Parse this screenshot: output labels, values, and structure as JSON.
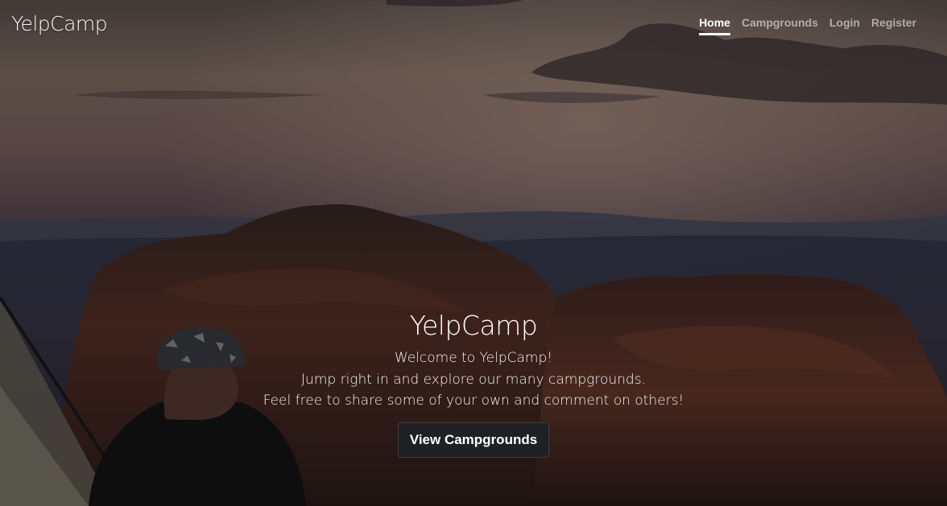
{
  "brand": {
    "name": "YelpCamp"
  },
  "nav": {
    "items": [
      {
        "label": "Home",
        "active": true
      },
      {
        "label": "Campgrounds",
        "active": false
      },
      {
        "label": "Login",
        "active": false
      },
      {
        "label": "Register",
        "active": false
      }
    ]
  },
  "hero": {
    "title": "YelpCamp",
    "lines": [
      "Welcome to YelpCamp!",
      "Jump right in and explore our many campgrounds.",
      "Feel free to share some of your own and comment on others!"
    ],
    "button_label": "View Campgrounds"
  },
  "colors": {
    "nav_active": "#ffffff",
    "nav_inactive": "#8c8c8c",
    "button_bg": "#1f2023"
  }
}
